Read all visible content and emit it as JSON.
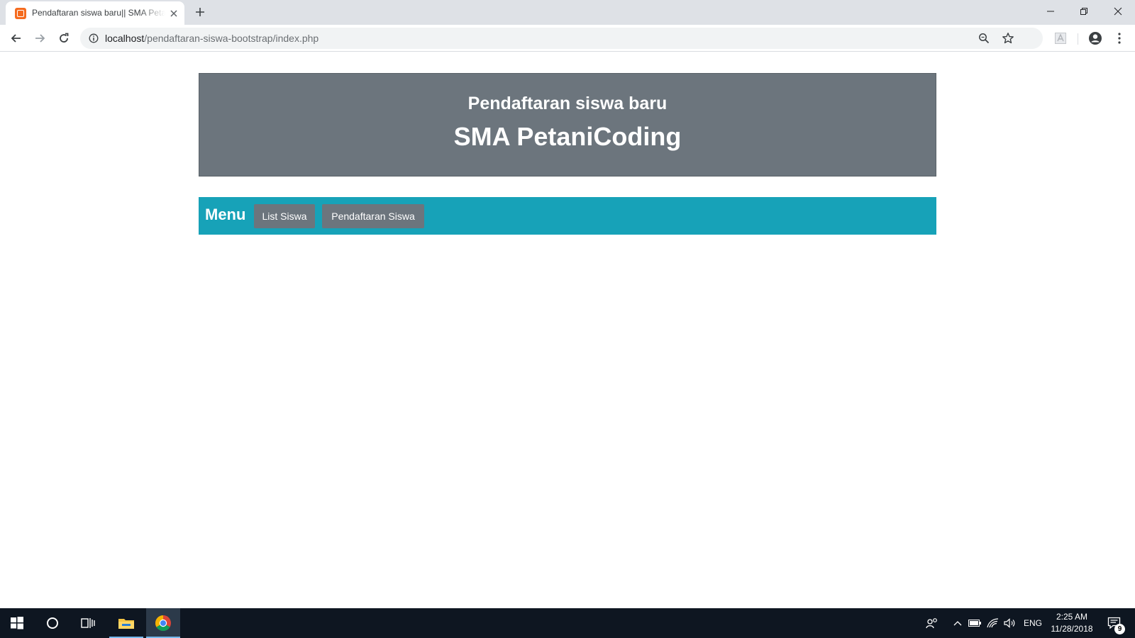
{
  "browser": {
    "tab": {
      "title": "Pendaftaran siswa baru|| SMA PetaniCoding",
      "favicon": "xampp-icon",
      "close_icon": "close-icon"
    },
    "new_tab_icon": "plus-icon",
    "window_controls": [
      "minimize-icon",
      "restore-icon",
      "close-icon"
    ],
    "nav": [
      "back-arrow-icon",
      "forward-arrow-icon",
      "reload-icon"
    ],
    "address": {
      "host": "localhost",
      "path": "/pendaftaran-siswa-bootstrap/index.php"
    },
    "toolbar_icons": [
      "zoom-icon",
      "star-icon",
      "pdf-extension-icon",
      "profile-icon",
      "kebab-menu-icon"
    ]
  },
  "page": {
    "header": {
      "subtitle": "Pendaftaran siswa baru",
      "title": "SMA PetaniCoding"
    },
    "menu": {
      "label": "Menu",
      "items": [
        {
          "label": "List Siswa"
        },
        {
          "label": "Pendaftaran Siswa"
        }
      ]
    },
    "colors": {
      "header_bg": "#6c757d",
      "menu_bg": "#17a2b8",
      "button_bg": "#6c757d"
    }
  },
  "taskbar": {
    "apps": [
      "windows-start-icon",
      "cortana-circle-icon",
      "task-view-icon",
      "file-explorer-icon",
      "chrome-icon"
    ],
    "tray": {
      "language": "ENG",
      "time": "2:25 AM",
      "date": "11/28/2018",
      "notification_count": "9"
    }
  }
}
